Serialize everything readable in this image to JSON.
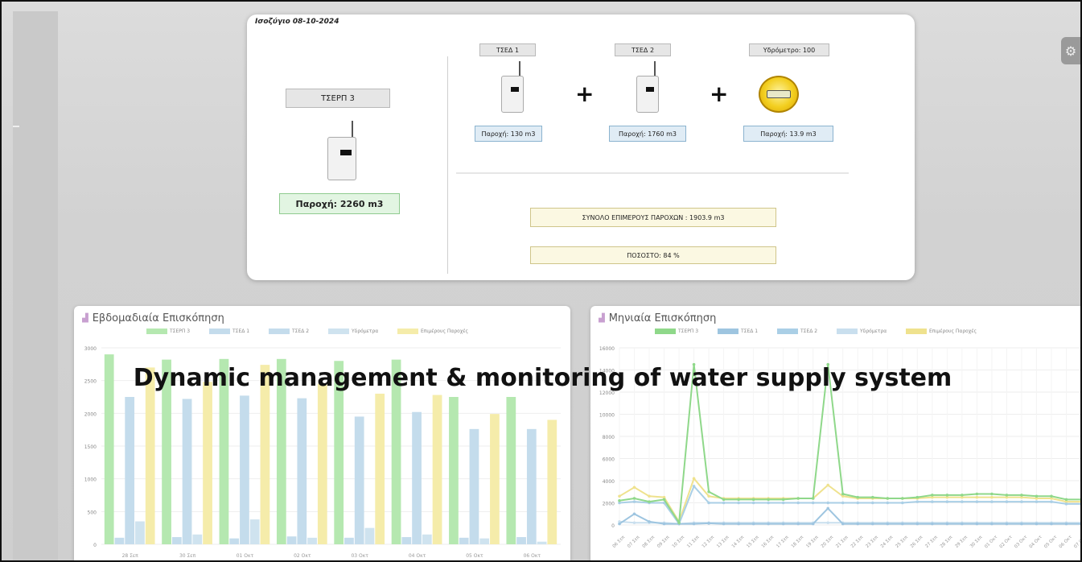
{
  "balance": {
    "date": "Ισοζύγιο 08-10-2024",
    "main_meter": {
      "name": "ΤΣΕΡΠ 3",
      "flow": "Παροχή: 2260 m3"
    },
    "sub_meters": [
      {
        "name": "ΤΣΕΔ 1",
        "flow": "Παροχή: 130 m3"
      },
      {
        "name": "ΤΣΕΔ 2",
        "flow": "Παροχή: 1760 m3"
      },
      {
        "name": "Υδρόμετρο: 100",
        "flow": "Παροχή: 13.9 m3"
      }
    ],
    "plus_sign": "+",
    "sum_label": "ΣΥΝΟΛΟ ΕΠΙΜΕΡΟΥΣ ΠΑΡΟΧΩΝ : 1903.9 m3",
    "percent_label": "ΠΟΣΟΣΤΟ: 84 %"
  },
  "overlay_caption": "Dynamic management & monitoring of water supply system",
  "icons": {
    "settings": "gear-icon",
    "chart": "bar-chart-icon"
  },
  "colors": {
    "green": "#b5e8b0",
    "lightblue": "#c4dcec",
    "blue2": "#cfe3ef",
    "yellow": "#f5ecaa"
  },
  "chart_data": [
    {
      "type": "bar",
      "title": "Εβδομαδιαία Επισκόπηση",
      "categories": [
        "28 Σεπ",
        "30 Σεπ",
        "01 Οκτ",
        "02 Οκτ",
        "03 Οκτ",
        "04 Οκτ",
        "05 Οκτ",
        "06 Οκτ"
      ],
      "ylim": [
        0,
        3000
      ],
      "yticks": [
        "0",
        "500",
        "1000",
        "1500",
        "2000",
        "2500",
        "3000"
      ],
      "legend": [
        "ΤΣΕΡΠ 3",
        "ΤΣΕΔ 1",
        "ΤΣΕΔ 2",
        "Υδρόμετρα",
        "Επιμέρους Παροχές"
      ],
      "series": [
        {
          "name": "ΤΣΕΡΠ 3",
          "color": "#b5e8b0",
          "values": [
            2900,
            2820,
            2830,
            2830,
            2800,
            2820,
            2250,
            2250
          ]
        },
        {
          "name": "ΤΣΕΔ 1",
          "color": "#c4dcec",
          "values": [
            100,
            110,
            90,
            120,
            100,
            110,
            100,
            110
          ]
        },
        {
          "name": "ΤΣΕΔ 2",
          "color": "#c4dcec",
          "values": [
            2250,
            2220,
            2270,
            2230,
            1950,
            2020,
            1760,
            1760
          ]
        },
        {
          "name": "Υδρόμετρα",
          "color": "#cfe3ef",
          "values": [
            350,
            150,
            380,
            100,
            250,
            150,
            90,
            40
          ]
        },
        {
          "name": "Επιμέρους Παροχές",
          "color": "#f5ecaa",
          "values": [
            2700,
            2480,
            2740,
            2450,
            2300,
            2280,
            1990,
            1900
          ]
        }
      ]
    },
    {
      "type": "line",
      "title": "Μηνιαία Επισκόπηση",
      "ylim": [
        0,
        16000
      ],
      "yticks": [
        "0",
        "2000",
        "4000",
        "6000",
        "8000",
        "10000",
        "12000",
        "14000",
        "16000"
      ],
      "legend": [
        "ΤΣΕΡΠ 3",
        "ΤΣΕΔ 1",
        "ΤΣΕΔ 2",
        "Υδρόμετρα",
        "Επιμέρους Παροχές"
      ],
      "categories": [
        "06 Σεπ",
        "07 Σεπ",
        "08 Σεπ",
        "09 Σεπ",
        "10 Σεπ",
        "11 Σεπ",
        "12 Σεπ",
        "13 Σεπ",
        "14 Σεπ",
        "15 Σεπ",
        "16 Σεπ",
        "17 Σεπ",
        "18 Σεπ",
        "19 Σεπ",
        "20 Σεπ",
        "21 Σεπ",
        "22 Σεπ",
        "23 Σεπ",
        "24 Σεπ",
        "25 Σεπ",
        "26 Σεπ",
        "27 Σεπ",
        "28 Σεπ",
        "29 Σεπ",
        "30 Σεπ",
        "01 Οκτ",
        "02 Οκτ",
        "03 Οκτ",
        "04 Οκτ",
        "05 Οκτ",
        "06 Οκτ",
        "07 Οκτ"
      ],
      "series": [
        {
          "name": "ΤΣΕΡΠ 3",
          "color": "#8fd88a",
          "values": [
            2200,
            2400,
            2100,
            2300,
            200,
            14500,
            3000,
            2300,
            2300,
            2300,
            2300,
            2300,
            2400,
            2400,
            14500,
            2800,
            2500,
            2500,
            2400,
            2400,
            2500,
            2700,
            2700,
            2700,
            2800,
            2800,
            2700,
            2700,
            2600,
            2600,
            2300,
            2300
          ]
        },
        {
          "name": "ΤΣΕΔ 1",
          "color": "#9ec5e0",
          "values": [
            100,
            1000,
            300,
            100,
            100,
            100,
            150,
            100,
            100,
            100,
            100,
            100,
            100,
            100,
            1500,
            100,
            100,
            100,
            100,
            100,
            100,
            100,
            100,
            100,
            100,
            100,
            100,
            100,
            100,
            100,
            100,
            100
          ]
        },
        {
          "name": "ΤΣΕΔ 2",
          "color": "#aacfe6",
          "values": [
            2000,
            2100,
            2000,
            2000,
            100,
            3500,
            2000,
            2000,
            2000,
            2000,
            2000,
            2000,
            2000,
            2000,
            2000,
            2000,
            2000,
            2000,
            2000,
            2000,
            2100,
            2100,
            2100,
            2100,
            2100,
            2100,
            2100,
            2100,
            2100,
            2100,
            1900,
            1900
          ]
        },
        {
          "name": "Υδρόμετρα",
          "color": "#c9dfee",
          "values": [
            300,
            200,
            200,
            200,
            100,
            200,
            200,
            200,
            200,
            200,
            200,
            200,
            200,
            200,
            200,
            200,
            200,
            200,
            200,
            200,
            200,
            200,
            200,
            200,
            200,
            200,
            200,
            200,
            200,
            200,
            200,
            200
          ]
        },
        {
          "name": "Επιμέρους Παροχές",
          "color": "#efe28e",
          "values": [
            2600,
            3400,
            2600,
            2500,
            300,
            4200,
            2600,
            2400,
            2400,
            2400,
            2400,
            2400,
            2400,
            2400,
            3600,
            2600,
            2400,
            2400,
            2400,
            2400,
            2400,
            2500,
            2500,
            2500,
            2500,
            2500,
            2500,
            2500,
            2400,
            2400,
            2100,
            2100
          ]
        }
      ]
    }
  ]
}
